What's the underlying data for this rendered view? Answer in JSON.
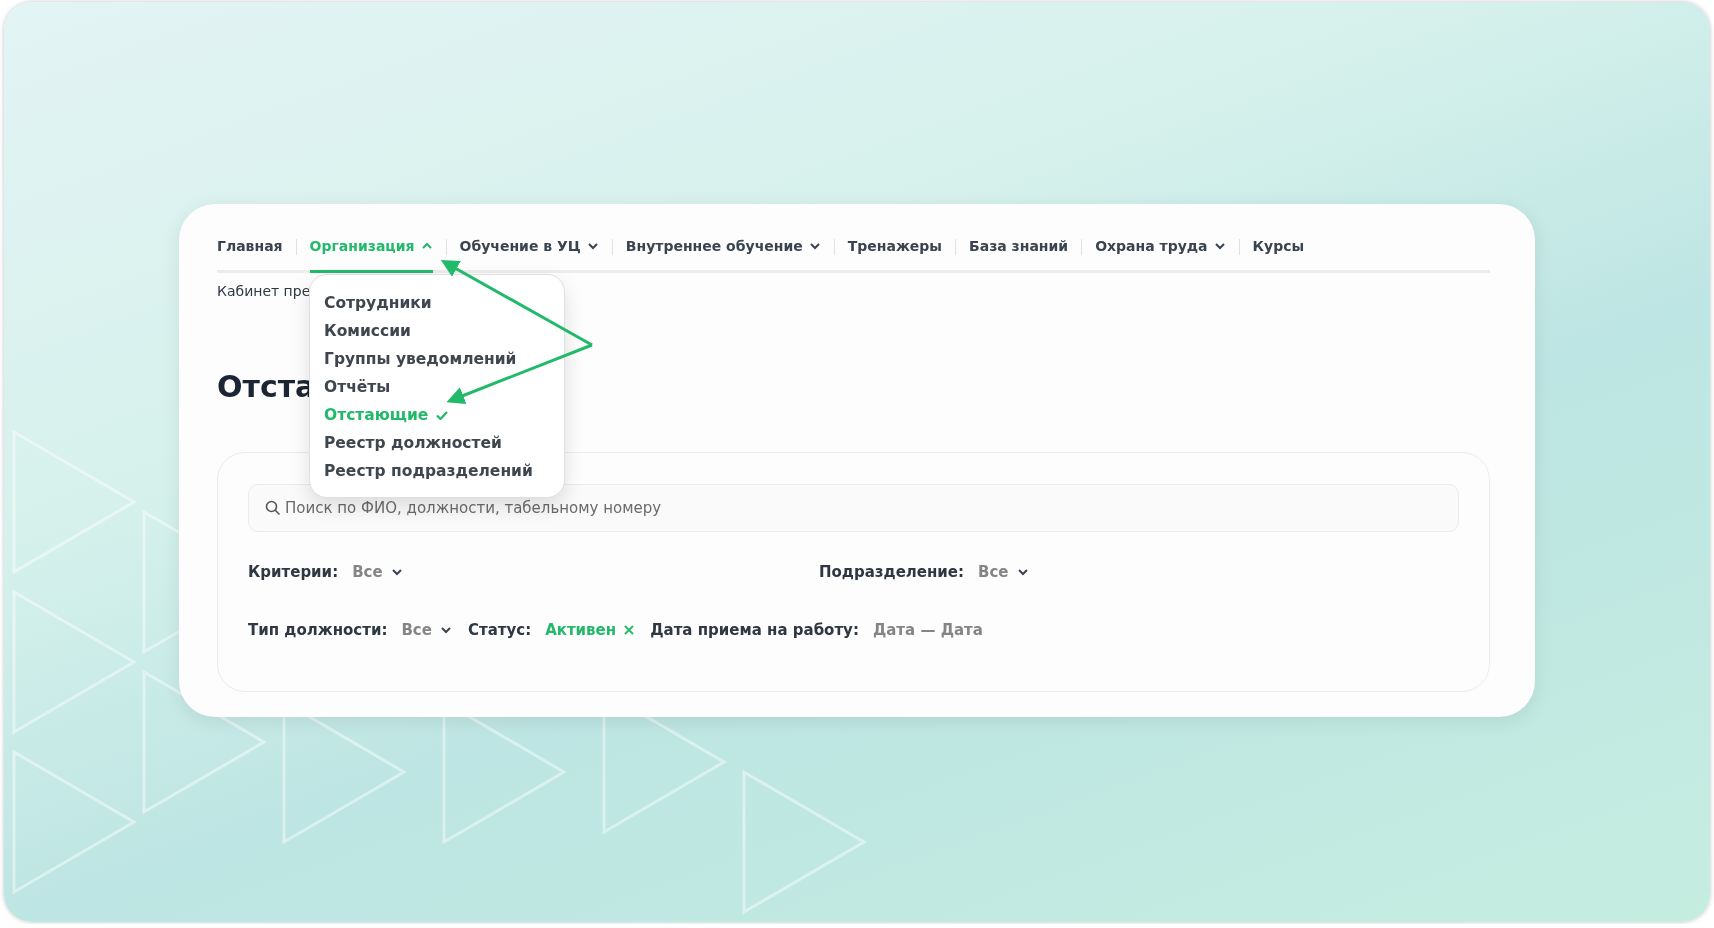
{
  "nav": [
    {
      "label": "Главная",
      "selected": false,
      "kind": "link"
    },
    {
      "label": "Организация",
      "selected": true,
      "kind": "menu",
      "expanded": true
    },
    {
      "label": "Обучение в УЦ",
      "selected": false,
      "kind": "menu",
      "expanded": false
    },
    {
      "label": "Внутреннее обучение",
      "selected": false,
      "kind": "menu",
      "expanded": false
    },
    {
      "label": "Тренажеры",
      "selected": false,
      "kind": "link"
    },
    {
      "label": "База знаний",
      "selected": false,
      "kind": "link"
    },
    {
      "label": "Охрана труда",
      "selected": false,
      "kind": "menu",
      "expanded": false
    },
    {
      "label": "Курсы",
      "selected": false,
      "kind": "link"
    }
  ],
  "breadcrumb": "Кабинет пре",
  "heading": "Отста",
  "dropdown": {
    "items": [
      {
        "label": "Сотрудники",
        "selected": false
      },
      {
        "label": "Комиссии",
        "selected": false
      },
      {
        "label": "Группы уведомлений",
        "selected": false
      },
      {
        "label": "Отчёты",
        "selected": false
      },
      {
        "label": "Отстающие",
        "selected": true
      },
      {
        "label": "Реестр должностей",
        "selected": false
      },
      {
        "label": "Реестр подразделений",
        "selected": false
      }
    ]
  },
  "search": {
    "placeholder": "Поиск по ФИО, должности, табельному номеру"
  },
  "filter_rows": [
    [
      {
        "label": "Критерии:",
        "value": "Все",
        "kind": "select"
      },
      {
        "label": "Подразделение:",
        "value": "Все",
        "kind": "select"
      }
    ],
    [
      {
        "label": "Тип должности:",
        "value": "Все",
        "kind": "select"
      },
      {
        "label": "Статус:",
        "value": "Активен",
        "kind": "chip"
      },
      {
        "label": "Дата приема на работу:",
        "value": "Дата — Дата",
        "kind": "range"
      }
    ]
  ]
}
